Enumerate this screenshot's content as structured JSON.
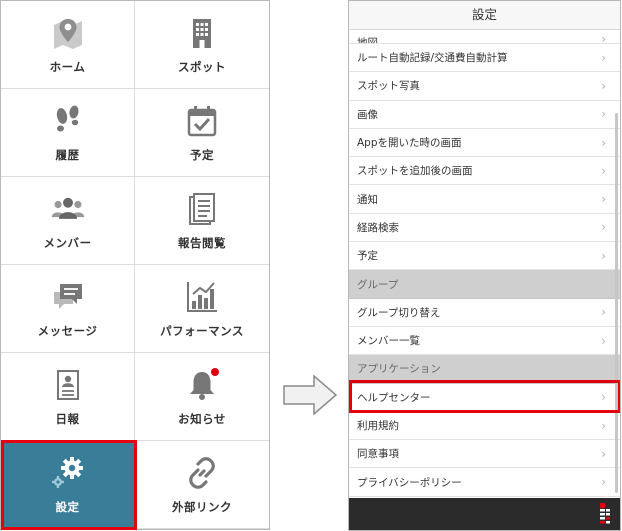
{
  "menu": {
    "tiles": [
      {
        "label": "ホーム",
        "icon": "map-pin-icon"
      },
      {
        "label": "スポット",
        "icon": "building-icon"
      },
      {
        "label": "履歴",
        "icon": "footprints-icon"
      },
      {
        "label": "予定",
        "icon": "calendar-check-icon"
      },
      {
        "label": "メンバー",
        "icon": "people-icon"
      },
      {
        "label": "報告閲覧",
        "icon": "document-icon"
      },
      {
        "label": "メッセージ",
        "icon": "chat-icon"
      },
      {
        "label": "パフォーマンス",
        "icon": "bar-chart-icon"
      },
      {
        "label": "日報",
        "icon": "report-icon"
      },
      {
        "label": "お知らせ",
        "icon": "bell-icon"
      },
      {
        "label": "設定",
        "icon": "gear-icon"
      },
      {
        "label": "外部リンク",
        "icon": "link-icon"
      }
    ],
    "active_tile": "設定",
    "active_color": "#3a7d99",
    "highlight_color": "#e3000f"
  },
  "settings": {
    "title": "設定",
    "rows": [
      {
        "label": "地図",
        "type": "item"
      },
      {
        "label": "ルート自動記録/交通費自動計算",
        "type": "item"
      },
      {
        "label": "スポット写真",
        "type": "item"
      },
      {
        "label": "画像",
        "type": "item"
      },
      {
        "label": "Appを開いた時の画面",
        "type": "item"
      },
      {
        "label": "スポットを追加後の画面",
        "type": "item"
      },
      {
        "label": "通知",
        "type": "item"
      },
      {
        "label": "経路検索",
        "type": "item"
      },
      {
        "label": "予定",
        "type": "item"
      },
      {
        "label": "グループ",
        "type": "section"
      },
      {
        "label": "グループ切り替え",
        "type": "item"
      },
      {
        "label": "メンバー一覧",
        "type": "item"
      },
      {
        "label": "アプリケーション",
        "type": "section"
      },
      {
        "label": "ヘルプセンター",
        "type": "item"
      },
      {
        "label": "利用規約",
        "type": "item"
      },
      {
        "label": "同意事項",
        "type": "item"
      },
      {
        "label": "プライバシーポリシー",
        "type": "item"
      }
    ],
    "chevron": "›",
    "highlighted_row": "ヘルプセンター"
  }
}
